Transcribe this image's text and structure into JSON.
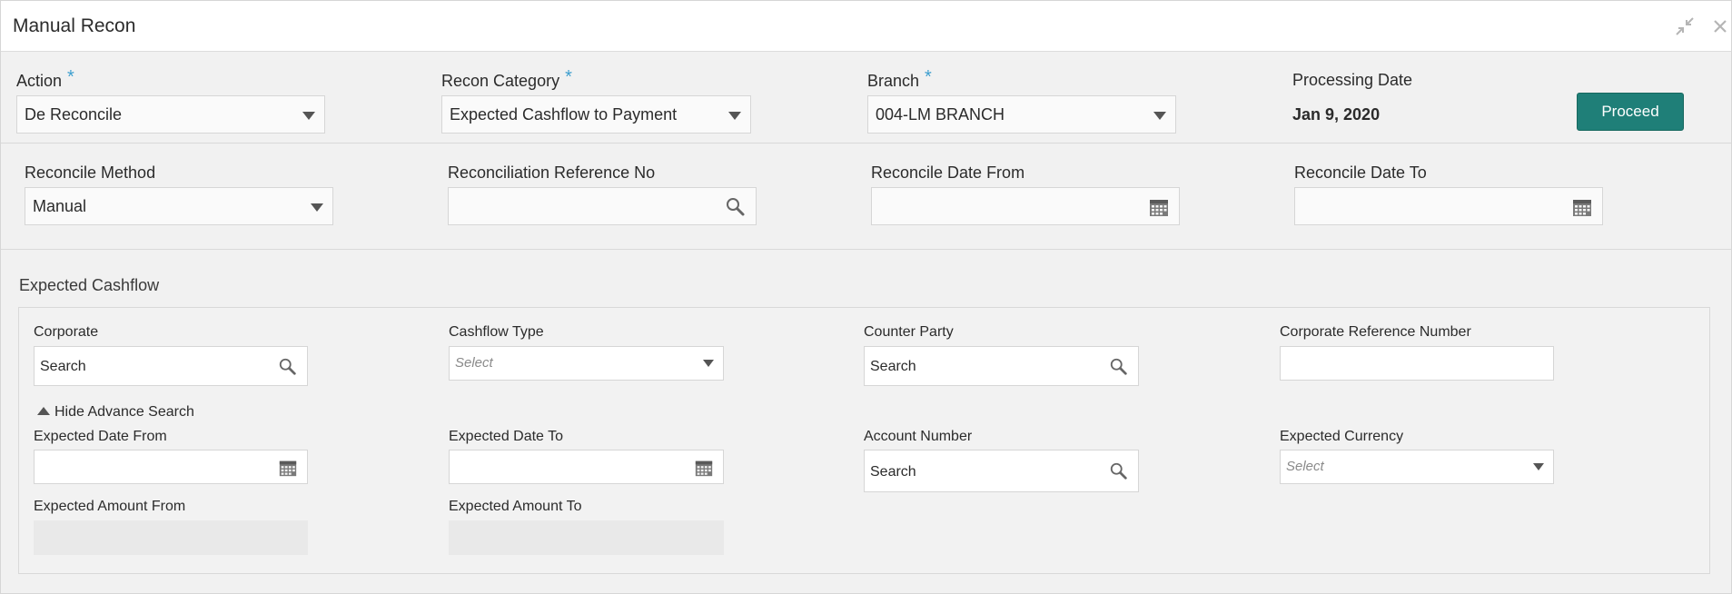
{
  "window": {
    "title": "Manual Recon"
  },
  "filters": {
    "action": {
      "label": "Action",
      "required": "*",
      "value": "De Reconcile"
    },
    "recon_category": {
      "label": "Recon Category",
      "required": "*",
      "value": "Expected Cashflow to Payment"
    },
    "branch": {
      "label": "Branch",
      "required": "*",
      "value": "004-LM BRANCH"
    },
    "processing_date": {
      "label": "Processing Date",
      "value": "Jan 9, 2020"
    },
    "proceed_label": "Proceed"
  },
  "recon": {
    "method": {
      "label": "Reconcile Method",
      "value": "Manual"
    },
    "reference": {
      "label": "Reconciliation Reference No",
      "value": ""
    },
    "date_from": {
      "label": "Reconcile Date From",
      "value": ""
    },
    "date_to": {
      "label": "Reconcile Date To",
      "value": ""
    }
  },
  "expected_cashflow": {
    "title": "Expected Cashflow",
    "corporate": {
      "label": "Corporate",
      "value": "Search"
    },
    "cashflow_type": {
      "label": "Cashflow Type",
      "placeholder": "Select"
    },
    "counter_party": {
      "label": "Counter Party",
      "value": "Search"
    },
    "corporate_reference": {
      "label": "Corporate Reference Number",
      "value": ""
    },
    "advance_toggle": "Hide Advance Search",
    "expected_date_from": {
      "label": "Expected Date From",
      "value": ""
    },
    "expected_date_to": {
      "label": "Expected Date To",
      "value": ""
    },
    "account_number": {
      "label": "Account Number",
      "value": "Search"
    },
    "expected_currency": {
      "label": "Expected Currency",
      "placeholder": "Select"
    },
    "expected_amount_from": {
      "label": "Expected Amount From",
      "value": ""
    },
    "expected_amount_to": {
      "label": "Expected Amount To",
      "value": ""
    }
  },
  "colors": {
    "accent": "#1f7f78",
    "required": "#3e9fcf"
  }
}
